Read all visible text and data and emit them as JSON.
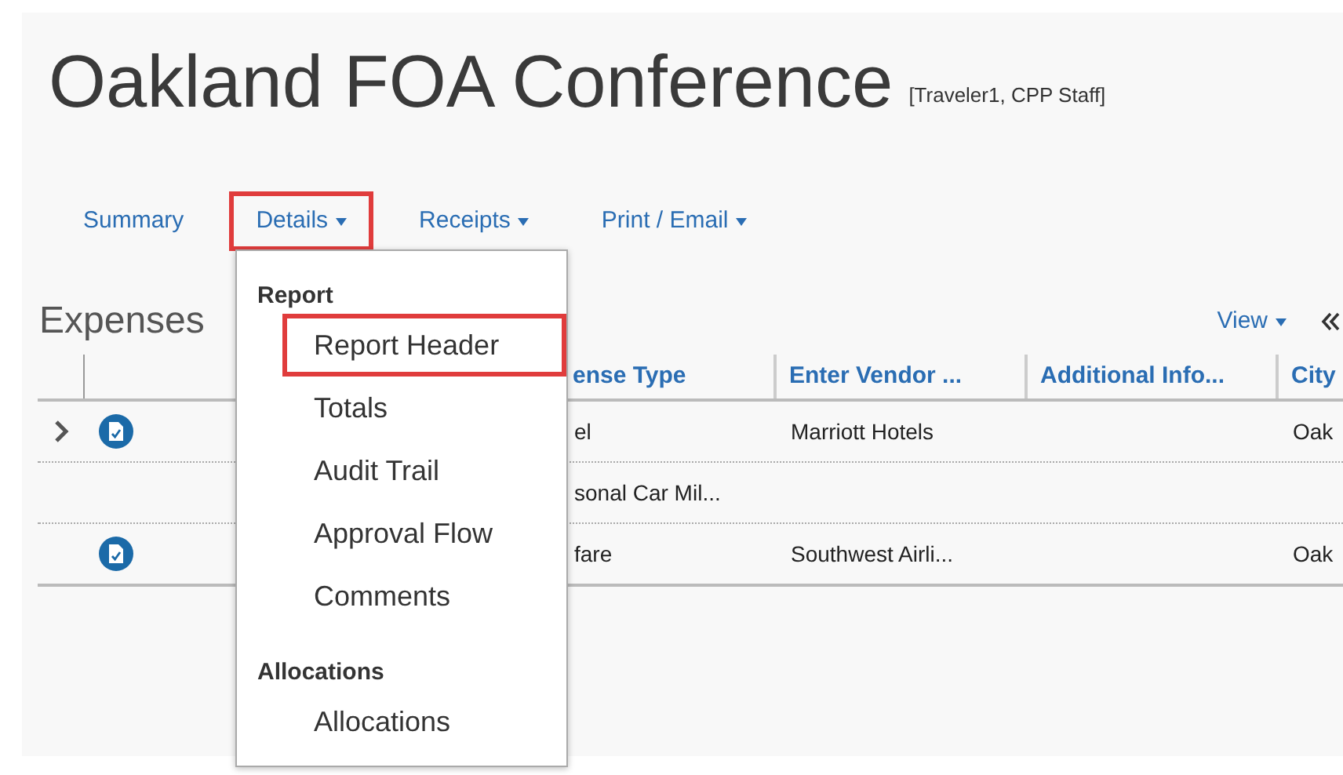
{
  "title": "Oakland FOA Conference",
  "subtitle": "[Traveler1, CPP Staff]",
  "tabs": [
    {
      "label": "Summary",
      "has_dropdown": false,
      "highlighted": false
    },
    {
      "label": "Details",
      "has_dropdown": true,
      "highlighted": true
    },
    {
      "label": "Receipts",
      "has_dropdown": true,
      "highlighted": false
    },
    {
      "label": "Print / Email",
      "has_dropdown": true,
      "highlighted": false
    }
  ],
  "expenses": {
    "heading": "Expenses",
    "view_button": "View",
    "columns": [
      "ense Type",
      "Enter Vendor ...",
      "Additional Info...",
      "City"
    ],
    "rows": [
      {
        "expandable": true,
        "receipt_icon": true,
        "cells": [
          "el",
          "Marriott Hotels",
          "",
          "Oak"
        ]
      },
      {
        "expandable": false,
        "receipt_icon": false,
        "cells": [
          "sonal Car Mil...",
          "",
          "",
          ""
        ]
      },
      {
        "expandable": false,
        "receipt_icon": true,
        "cells": [
          "fare",
          "Southwest Airli...",
          "",
          "Oak"
        ]
      }
    ]
  },
  "details_menu": {
    "groups": [
      {
        "heading": "Report",
        "items": [
          {
            "label": "Report Header",
            "highlighted": true
          },
          {
            "label": "Totals",
            "highlighted": false
          },
          {
            "label": "Audit Trail",
            "highlighted": false
          },
          {
            "label": "Approval Flow",
            "highlighted": false
          },
          {
            "label": "Comments",
            "highlighted": false
          }
        ]
      },
      {
        "heading": "Allocations",
        "items": [
          {
            "label": "Allocations",
            "highlighted": false
          }
        ]
      }
    ]
  }
}
